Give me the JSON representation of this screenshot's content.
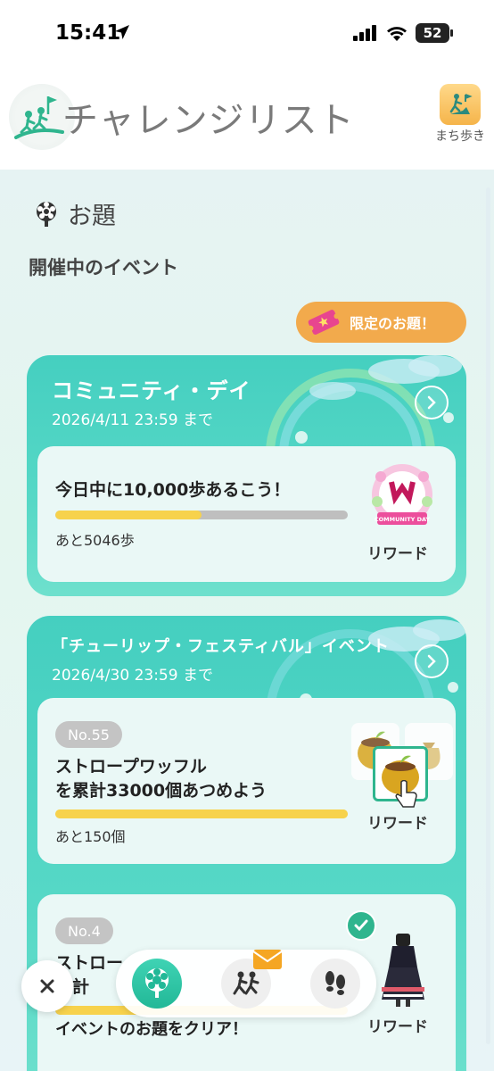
{
  "status_bar": {
    "time": "15:41",
    "battery": "52"
  },
  "header": {
    "title": "チャレンジリスト",
    "machi_label": "まち歩き"
  },
  "section": {
    "title": "お題",
    "events_heading": "開催中のイベント",
    "limited_label": "限定のお題！"
  },
  "events": [
    {
      "name": "コミュニティ・デイ",
      "date": "2026/4/11 23:59 まで",
      "task": {
        "title": "今日中に10,000歩あるこう！",
        "progress": 0.5,
        "remaining": "あと5046歩",
        "reward_label": "リワード",
        "reward_badge": "COMMUNITY DAY"
      }
    },
    {
      "name": "「チューリップ・フェスティバル」イベント",
      "date": "2026/4/30 23:59 まで",
      "task": {
        "number": "No.55",
        "title_line1": "ストロープワッフル",
        "title_line2": "を累計33000個あつめよう",
        "progress": 1.0,
        "remaining": "あと150個",
        "reward_label": "リワード"
      },
      "task2": {
        "number": "No.4",
        "title_line1": "ストロー",
        "title_line2": "累計",
        "subtitle": "イベントのお題をクリア！",
        "reward_label": "リワード"
      }
    }
  ],
  "colors": {
    "accent": "#45cfc0",
    "progress": "#f7d24c",
    "limited": "#f2aa4c",
    "check": "#2fb58e"
  }
}
